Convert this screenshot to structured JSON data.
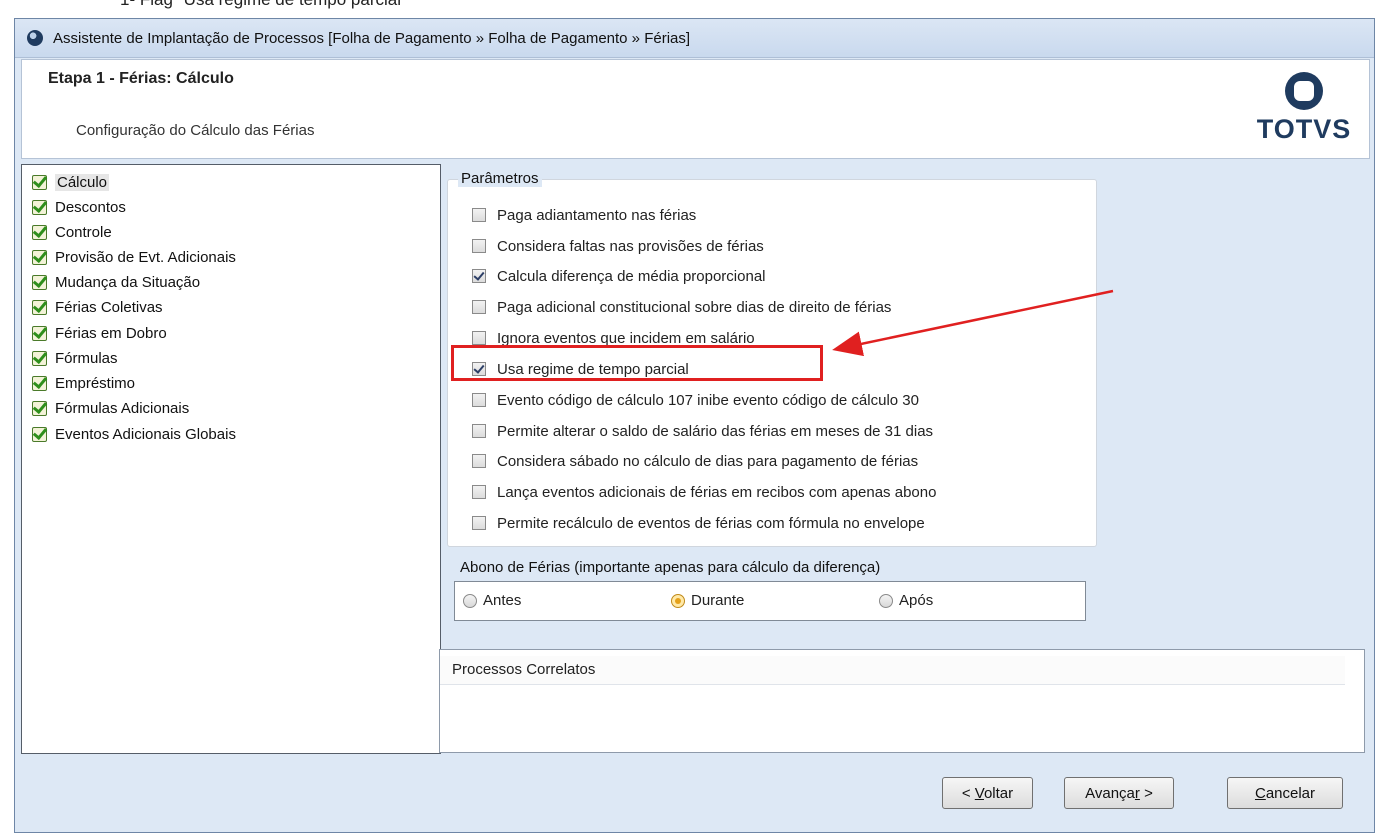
{
  "caption": "1- Flag \"Usa regime de tempo parcial\"",
  "window": {
    "title": "Assistente de Implantação de Processos [Folha de Pagamento » Folha de Pagamento » Férias]"
  },
  "header": {
    "step_title": "Etapa 1 - Férias: Cálculo",
    "step_subtitle": "Configuração do Cálculo das Férias",
    "logo_text": "TOTVS"
  },
  "tree": {
    "items": [
      {
        "label": "Cálculo",
        "selected": true
      },
      {
        "label": "Descontos"
      },
      {
        "label": "Controle"
      },
      {
        "label": "Provisão de Evt. Adicionais"
      },
      {
        "label": "Mudança da Situação"
      },
      {
        "label": "Férias Coletivas"
      },
      {
        "label": "Férias em Dobro"
      },
      {
        "label": "Fórmulas"
      },
      {
        "label": "Empréstimo"
      },
      {
        "label": "Fórmulas Adicionais"
      },
      {
        "label": "Eventos Adicionais Globais"
      }
    ]
  },
  "parametros": {
    "title": "Parâmetros",
    "options": [
      {
        "label": "Paga adiantamento nas férias",
        "checked": false
      },
      {
        "label": "Considera faltas nas provisões de férias",
        "checked": false
      },
      {
        "label": "Calcula diferença de média proporcional",
        "checked": true
      },
      {
        "label": "Paga adicional constitucional sobre dias de direito de férias",
        "checked": false
      },
      {
        "label": "Ignora eventos que incidem em salário",
        "checked": false
      },
      {
        "label": "Usa regime de tempo parcial",
        "checked": true
      },
      {
        "label": "Evento código de cálculo 107 inibe evento código de cálculo 30",
        "checked": false
      },
      {
        "label": "Permite alterar o saldo de salário das férias em meses de 31 dias",
        "checked": false
      },
      {
        "label": "Considera sábado no cálculo de dias para pagamento de férias",
        "checked": false
      },
      {
        "label": "Lança eventos adicionais de férias em recibos com apenas abono",
        "checked": false
      },
      {
        "label": "Permite recálculo de eventos de férias com fórmula no envelope",
        "checked": false
      }
    ]
  },
  "abono": {
    "title": "Abono de Férias (importante apenas para cálculo da diferença)",
    "options": [
      {
        "label": "Antes",
        "selected": false
      },
      {
        "label": "Durante",
        "selected": true
      },
      {
        "label": "Após",
        "selected": false
      }
    ]
  },
  "processos": {
    "title": "Processos Correlatos"
  },
  "buttons": {
    "voltar_prefix": "< ",
    "voltar_u": "V",
    "voltar_suffix": "oltar",
    "avancar_prefix": "Avança",
    "avancar_u": "r",
    "avancar_suffix": " >",
    "cancelar_u": "C",
    "cancelar_suffix": "ancelar"
  },
  "colors": {
    "highlight": "#e02020",
    "window_bg": "#dde8f5",
    "logo": "#1f3b5f"
  }
}
